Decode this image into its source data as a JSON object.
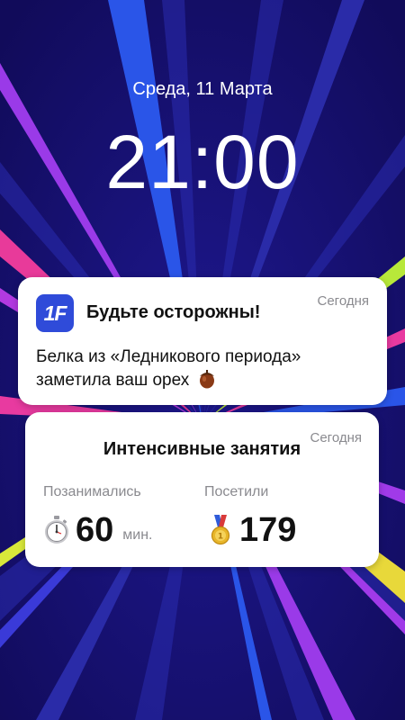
{
  "lockscreen": {
    "date": "Среда, 11 Марта",
    "time": "21:00"
  },
  "notification": {
    "app_icon_text": "1F",
    "title": "Будьте осторожны!",
    "timestamp": "Сегодня",
    "body": "Белка из «Ледникового периода» заметила ваш орех",
    "icon": "acorn-icon"
  },
  "widget": {
    "title": "Интенсивные занятия",
    "timestamp": "Сегодня",
    "stats": [
      {
        "label": "Позанимались",
        "value": "60",
        "unit": "мин.",
        "icon": "stopwatch-icon"
      },
      {
        "label": "Посетили",
        "value": "179",
        "unit": "",
        "icon": "medal-icon"
      }
    ]
  },
  "colors": {
    "wallpaper": "#150f6b",
    "app_icon": "#2f4bd9",
    "card": "#ffffff",
    "muted_text": "#8a8a8f"
  }
}
